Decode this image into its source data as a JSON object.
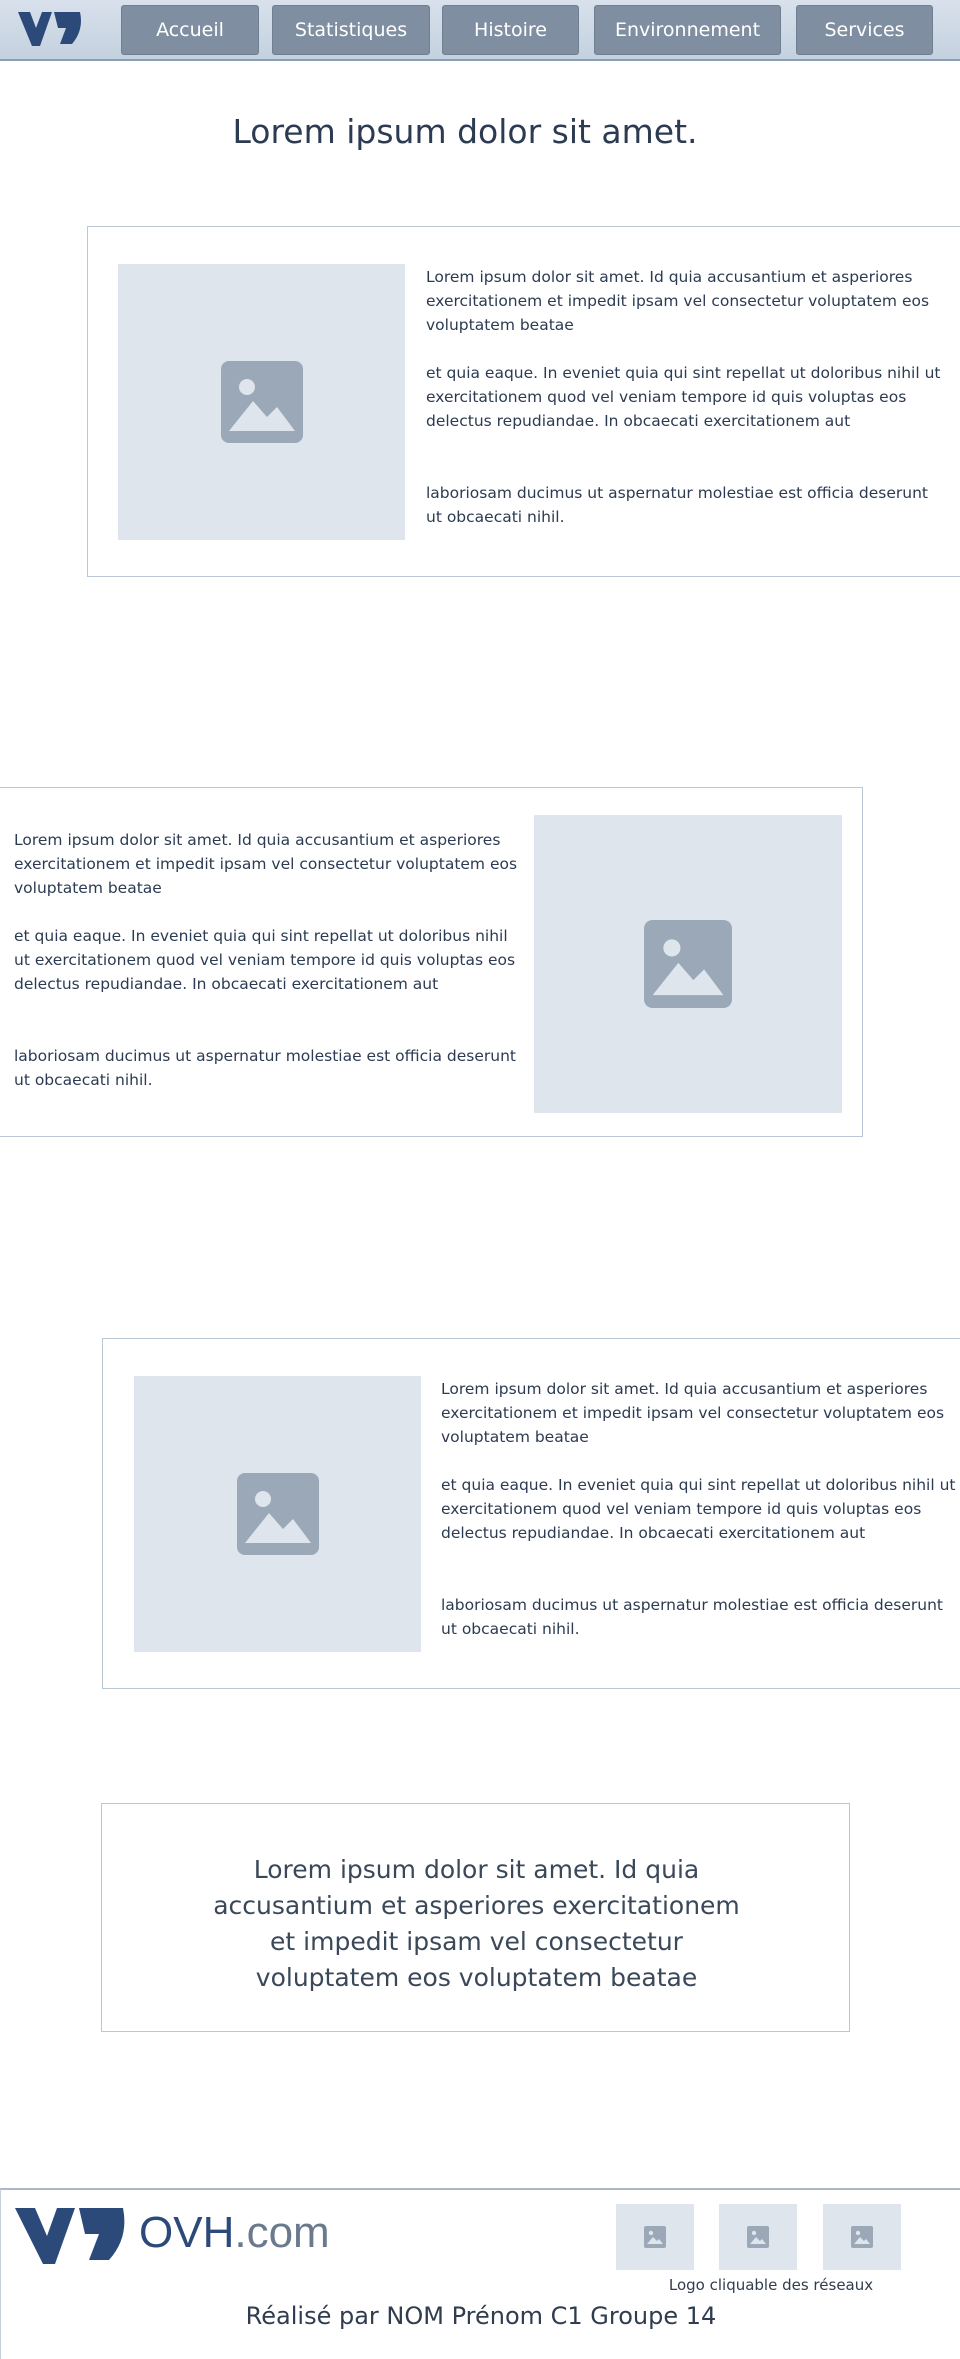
{
  "nav": {
    "items": [
      "Accueil",
      "Statistiques",
      "Histoire",
      "Environnement",
      "Services"
    ]
  },
  "main": {
    "title": "Lorem ipsum dolor sit amet.",
    "sections": [
      {
        "p1": "Lorem ipsum dolor sit amet. Id quia accusantium et asperiores exercitationem et impedit ipsam vel consectetur voluptatem eos voluptatem beatae",
        "p2": " et quia eaque. In eveniet quia qui sint repellat ut  doloribus nihil ut exercitationem quod vel veniam tempore id quis  voluptas eos delectus repudiandae. In obcaecati exercitationem aut",
        "p3": "laboriosam ducimus ut aspernatur molestiae est officia deserunt ut  obcaecati nihil."
      },
      {
        "p1": "Lorem ipsum dolor sit amet. Id quia accusantium et asperiores exercitationem et impedit ipsam vel consectetur voluptatem eos voluptatem beatae",
        "p2": " et quia eaque. In eveniet quia qui sint repellat ut  doloribus nihil ut exercitationem quod vel veniam tempore id quis  voluptas eos delectus repudiandae. In obcaecati exercitationem aut",
        "p3": "laboriosam ducimus ut aspernatur molestiae est officia deserunt ut  obcaecati nihil."
      },
      {
        "p1": "Lorem ipsum dolor sit amet. Id quia accusantium et asperiores exercitationem et impedit ipsam vel consectetur voluptatem eos voluptatem beatae",
        "p2": " et quia eaque. In eveniet quia qui sint repellat ut  doloribus nihil ut exercitationem quod vel veniam tempore id quis  voluptas eos delectus repudiandae. In obcaecati exercitationem aut",
        "p3": "laboriosam ducimus ut aspernatur molestiae est officia deserunt ut  obcaecati nihil."
      }
    ],
    "quote": "Lorem ipsum dolor sit amet. Id quia accusantium et asperiores  exercitationem et impedit ipsam vel consectetur voluptatem eos voluptatem beatae"
  },
  "footer": {
    "brand": "OVH",
    "brand_suffix": ".com",
    "social_caption": "Logo cliquable des réseaux",
    "credits": "Réalisé par NOM Prénom C1 Groupe 14"
  },
  "icons": {
    "logo": "ovh-logo-icon",
    "placeholder": "image-placeholder-icon"
  },
  "colors": {
    "brand": "#2b4a7a",
    "nav_button": "#7f8fa1",
    "placeholder_bg": "#dfe5ed",
    "placeholder_icon": "#9aa8b7",
    "card_border": "#b9c6d4"
  }
}
